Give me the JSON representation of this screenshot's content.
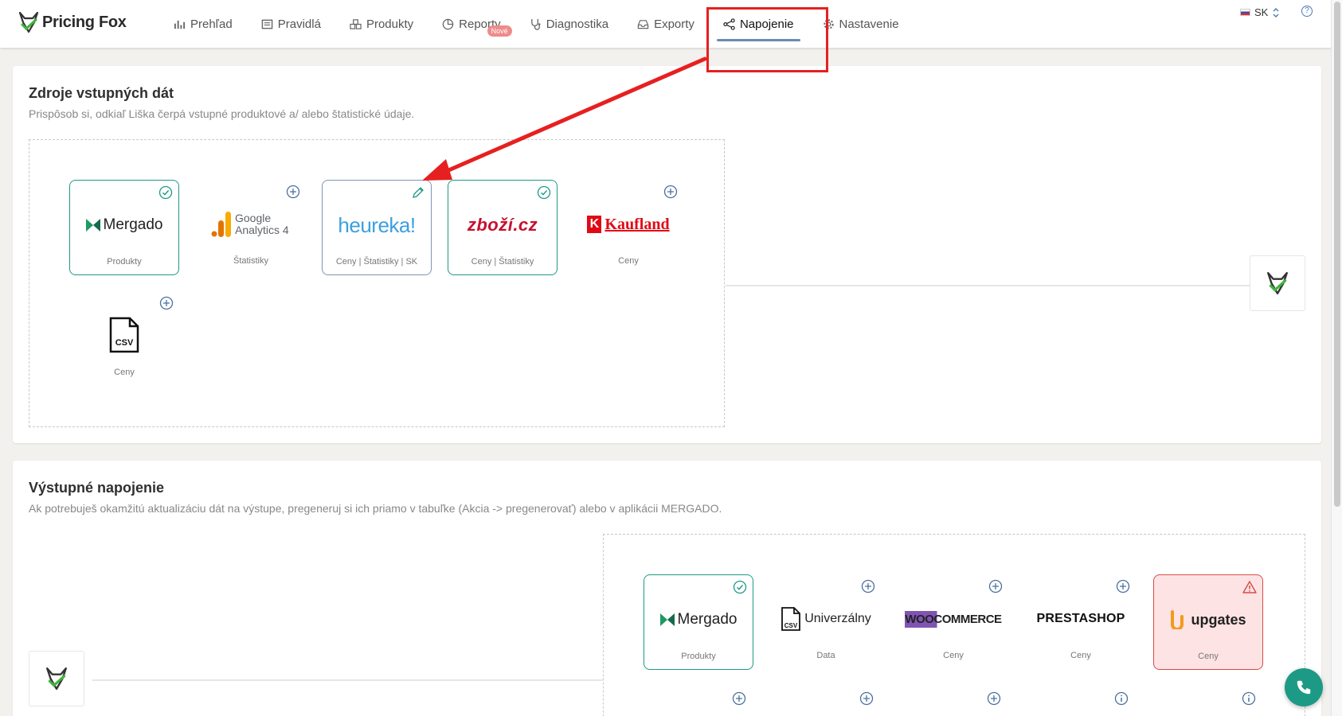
{
  "brand": {
    "name": "Pricing Fox"
  },
  "nav": {
    "items": [
      {
        "label": "Prehľad",
        "icon": "bar-chart-icon"
      },
      {
        "label": "Pravidlá",
        "icon": "list-icon"
      },
      {
        "label": "Produkty",
        "icon": "boxes-icon"
      },
      {
        "label": "Reporty",
        "icon": "pie-chart-icon",
        "badge": "Nové"
      },
      {
        "label": "Diagnostika",
        "icon": "stethoscope-icon"
      },
      {
        "label": "Exporty",
        "icon": "inbox-icon"
      },
      {
        "label": "Napojenie",
        "icon": "share-nodes-icon",
        "active": true
      },
      {
        "label": "Nastavenie",
        "icon": "gear-icon"
      }
    ]
  },
  "lang": {
    "code": "SK",
    "icon": "slovak-flag-icon"
  },
  "sources": {
    "title": "Zdroje vstupných dát",
    "description": "Prispôsob si, odkiaľ Liška čerpá vstupné produktové a/ alebo štatistické údaje.",
    "tiles": [
      {
        "name": "Mergado",
        "subtitle": "Produkty",
        "state": "connected"
      },
      {
        "name": "Google Analytics 4",
        "subtitle": "Štatistiky",
        "state": "add"
      },
      {
        "name": "heureka!",
        "subtitle": "Ceny | Štatistiky | SK",
        "state": "edit"
      },
      {
        "name": "zboží.cz",
        "subtitle": "Ceny | Štatistiky",
        "state": "connected"
      },
      {
        "name": "Kaufland",
        "subtitle": "Ceny",
        "state": "add"
      },
      {
        "name": "CSV",
        "subtitle": "Ceny",
        "state": "add"
      }
    ]
  },
  "outputs": {
    "title": "Výstupné napojenie",
    "description": "Ak potrebuješ okamžitú aktualizáciu dát na výstupe, pregeneruj si ich priamo v tabuľke (Akcia -> pregenerovať) alebo v aplikácii MERGADO.",
    "tiles": [
      {
        "name": "Mergado",
        "subtitle": "Produkty",
        "state": "connected"
      },
      {
        "name": "Univerzálny",
        "subtitle": "Data",
        "state": "add"
      },
      {
        "name": "WOOCOMMERCE",
        "subtitle": "Ceny",
        "state": "add"
      },
      {
        "name": "PRESTASHOP",
        "subtitle": "Ceny",
        "state": "add"
      },
      {
        "name": "upgates",
        "subtitle": "Ceny",
        "state": "error"
      }
    ]
  },
  "colors": {
    "accent": "#1d9a85",
    "edit": "#7d96b4",
    "error": "#d94a4a",
    "annotation": "#e62020"
  }
}
